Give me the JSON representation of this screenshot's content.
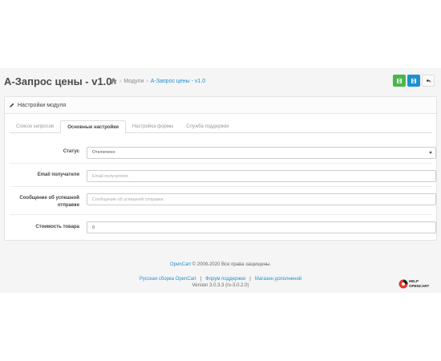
{
  "header": {
    "title": "А-Запрос цены - v1.0",
    "breadcrumbs": [
      "Модули",
      "А-Запрос цены - v1.0"
    ]
  },
  "panel": {
    "heading": "Настройки модуля"
  },
  "tabs": [
    "Список запросов",
    "Основные настройки",
    "Настройка формы",
    "Служба поддержки"
  ],
  "active_tab": "Основные настройки",
  "form": {
    "status_label": "Статус",
    "status_value": "Отключено",
    "email_label": "Email получателя",
    "email_placeholder": "Email получателя",
    "success_label": "Сообщение об успешной отправке",
    "success_placeholder": "Сообщение об успешной отправке",
    "price_label": "Стоимость товара",
    "price_value": "0"
  },
  "footer": {
    "opencart_link": "OpenCart",
    "copyright": "© 2009-2020 Все права защищены.",
    "link_ru": "Русская сборка OpenCart",
    "link_forum": "Форум поддержки",
    "link_shop": "Магазин дополнений",
    "separator": "|",
    "version": "Version 3.0.3.3 (rs-3.0.2.0)"
  },
  "logo": {
    "text_top": "HELP",
    "text_bottom": "OPENCART"
  },
  "colors": {
    "accent": "#1e91cf",
    "save_green": "#4cb64c"
  }
}
